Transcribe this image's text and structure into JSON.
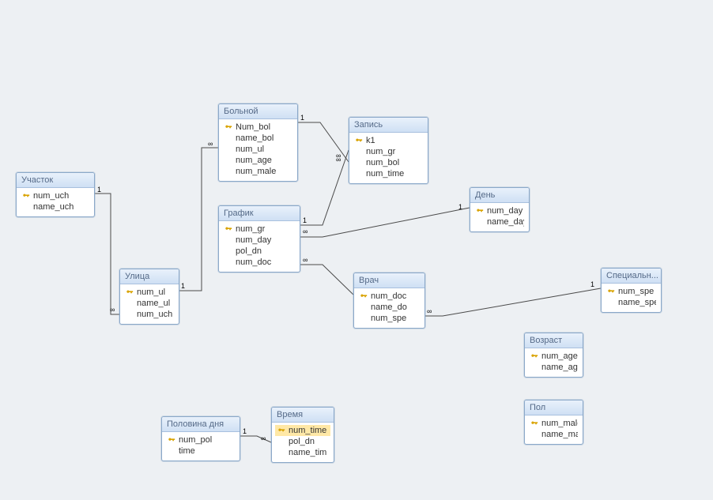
{
  "tables": {
    "uchastok": {
      "title": "Участок",
      "fields": [
        {
          "key": true,
          "name": "num_uch"
        },
        {
          "key": false,
          "name": "name_uch"
        }
      ]
    },
    "ulica": {
      "title": "Улица",
      "fields": [
        {
          "key": true,
          "name": "num_ul"
        },
        {
          "key": false,
          "name": "name_ul"
        },
        {
          "key": false,
          "name": "num_uch"
        }
      ]
    },
    "bolnoy": {
      "title": "Больной",
      "fields": [
        {
          "key": true,
          "name": "Num_bol"
        },
        {
          "key": false,
          "name": "name_bol"
        },
        {
          "key": false,
          "name": "num_ul"
        },
        {
          "key": false,
          "name": "num_age"
        },
        {
          "key": false,
          "name": "num_male"
        }
      ]
    },
    "zapis": {
      "title": "Запись",
      "fields": [
        {
          "key": true,
          "name": "k1"
        },
        {
          "key": false,
          "name": "num_gr"
        },
        {
          "key": false,
          "name": "num_bol"
        },
        {
          "key": false,
          "name": "num_time"
        }
      ]
    },
    "grafik": {
      "title": "График",
      "fields": [
        {
          "key": true,
          "name": "num_gr"
        },
        {
          "key": false,
          "name": "num_day"
        },
        {
          "key": false,
          "name": "pol_dn"
        },
        {
          "key": false,
          "name": "num_doc"
        }
      ]
    },
    "den": {
      "title": "День",
      "fields": [
        {
          "key": true,
          "name": "num_day"
        },
        {
          "key": false,
          "name": "name_day"
        }
      ]
    },
    "vrach": {
      "title": "Врач",
      "fields": [
        {
          "key": true,
          "name": "num_doc"
        },
        {
          "key": false,
          "name": "name_do"
        },
        {
          "key": false,
          "name": "num_spe"
        }
      ]
    },
    "spec": {
      "title": "Специальн...",
      "fields": [
        {
          "key": true,
          "name": "num_spe"
        },
        {
          "key": false,
          "name": "name_spe"
        }
      ]
    },
    "vozrast": {
      "title": "Возраст",
      "fields": [
        {
          "key": true,
          "name": "num_age"
        },
        {
          "key": false,
          "name": "name_age"
        }
      ]
    },
    "pol": {
      "title": "Пол",
      "fields": [
        {
          "key": true,
          "name": "num_male"
        },
        {
          "key": false,
          "name": "name_ma"
        }
      ]
    },
    "polovina": {
      "title": "Половина дня",
      "fields": [
        {
          "key": true,
          "name": "num_pol"
        },
        {
          "key": false,
          "name": "time"
        }
      ]
    },
    "vremya": {
      "title": "Время",
      "fields": [
        {
          "key": true,
          "name": "num_time",
          "selected": true
        },
        {
          "key": false,
          "name": "pol_dn"
        },
        {
          "key": false,
          "name": "name_tim"
        }
      ]
    }
  }
}
